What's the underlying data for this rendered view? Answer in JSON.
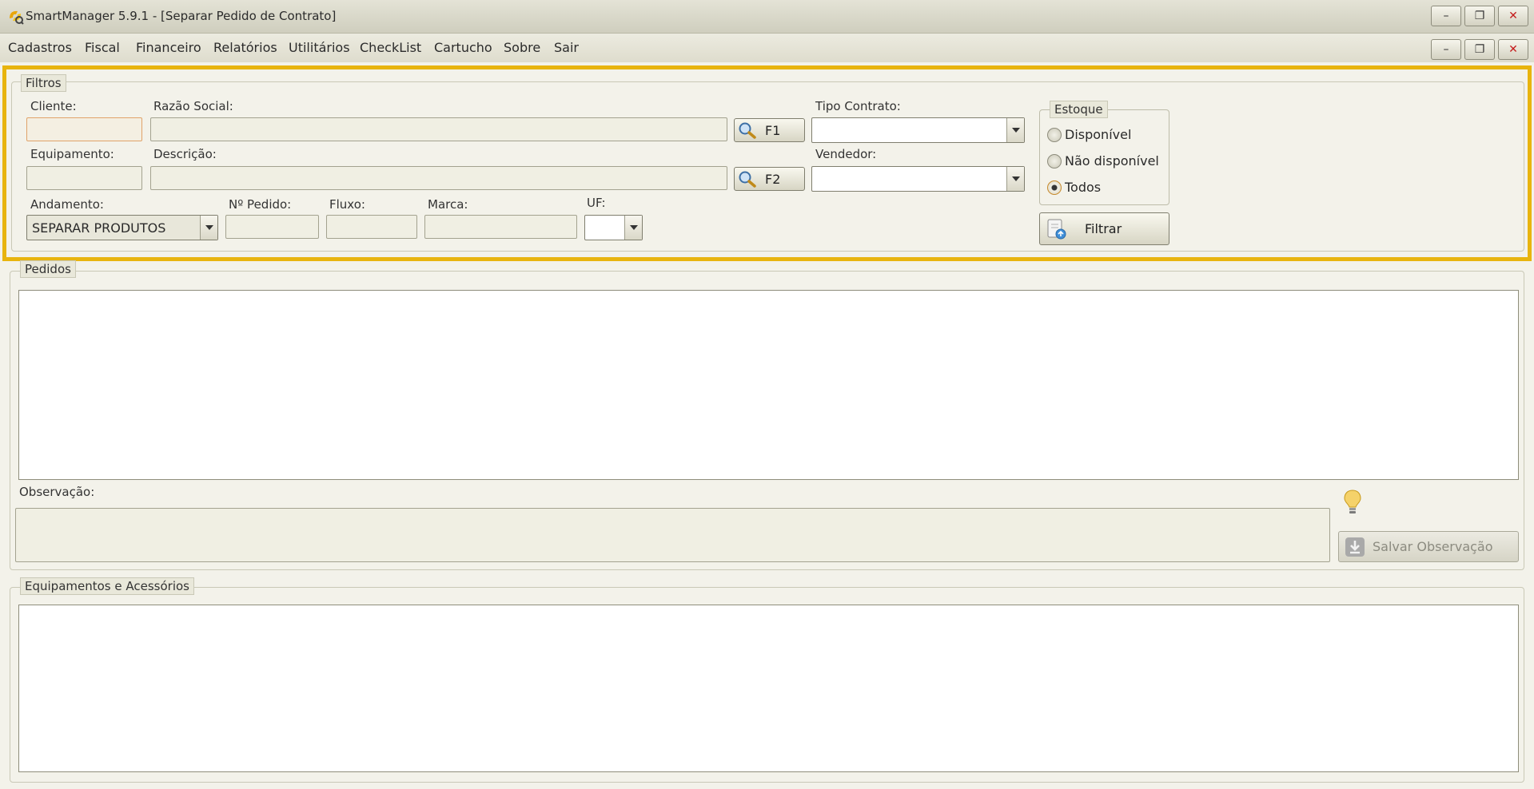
{
  "window": {
    "title": "SmartManager 5.9.1 - [Separar Pedido de Contrato]",
    "controls": {
      "minimize": "–",
      "restore": "❐",
      "close": "✕"
    }
  },
  "menu": {
    "items": [
      "Cadastros",
      "Fiscal",
      "Financeiro",
      "Relatórios",
      "Utilitários",
      "CheckList",
      "Cartucho",
      "Sobre",
      "Sair"
    ]
  },
  "filtros": {
    "legend": "Filtros",
    "cliente": {
      "label": "Cliente:",
      "value": ""
    },
    "razao_social": {
      "label": "Razão Social:",
      "value": ""
    },
    "f1_label": "F1",
    "tipo_contrato": {
      "label": "Tipo Contrato:",
      "value": ""
    },
    "equipamento": {
      "label": "Equipamento:",
      "value": ""
    },
    "descricao": {
      "label": "Descrição:",
      "value": ""
    },
    "f2_label": "F2",
    "vendedor": {
      "label": "Vendedor:",
      "value": ""
    },
    "andamento": {
      "label": "Andamento:",
      "value": "SEPARAR PRODUTOS"
    },
    "num_pedido": {
      "label": "Nº Pedido:",
      "value": ""
    },
    "fluxo": {
      "label": "Fluxo:",
      "value": ""
    },
    "marca": {
      "label": "Marca:",
      "value": ""
    },
    "uf": {
      "label": "UF:",
      "value": ""
    },
    "estoque": {
      "legend": "Estoque",
      "options": [
        "Disponível",
        "Não disponível",
        "Todos"
      ],
      "selected": "Todos"
    },
    "filtrar_label": "Filtrar"
  },
  "pedidos": {
    "legend": "Pedidos",
    "observacao_label": "Observação:",
    "observacao_value": "",
    "salvar_label": "Salvar Observação"
  },
  "equipamentos": {
    "legend": "Equipamentos e Acessórios"
  },
  "colors": {
    "highlight": "#e8b40e",
    "accent_orange": "#e0a36a"
  },
  "icons": [
    "app-logo-icon",
    "search-icon",
    "lightbulb-icon",
    "save-icon",
    "filter-icon"
  ]
}
